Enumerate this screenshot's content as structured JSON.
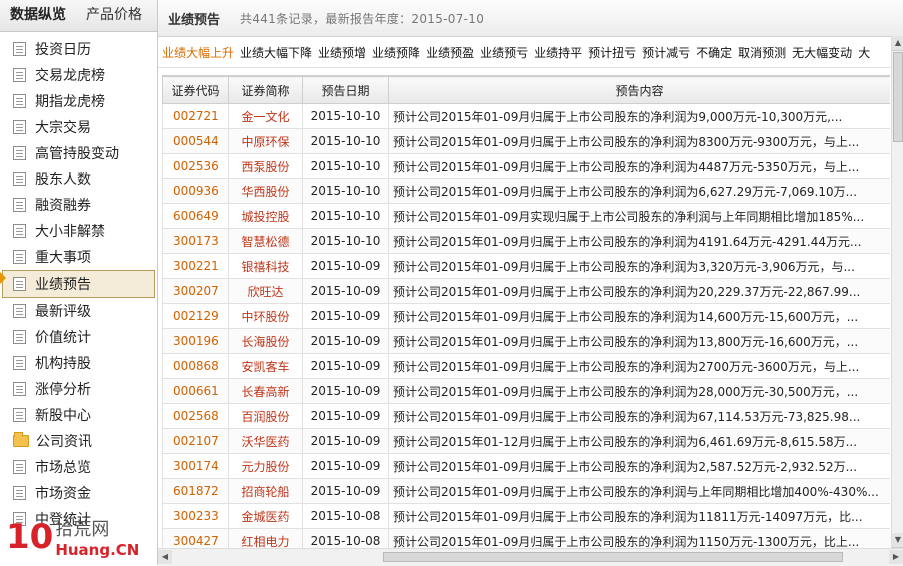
{
  "sidebar": {
    "tabs": [
      {
        "label": "数据纵览"
      },
      {
        "label": "产品价格"
      }
    ],
    "items": [
      {
        "label": "投资日历"
      },
      {
        "label": "交易龙虎榜"
      },
      {
        "label": "期指龙虎榜"
      },
      {
        "label": "大宗交易"
      },
      {
        "label": "高管持股变动"
      },
      {
        "label": "股东人数"
      },
      {
        "label": "融资融券"
      },
      {
        "label": "大小非解禁"
      },
      {
        "label": "重大事项"
      },
      {
        "label": "业绩预告"
      },
      {
        "label": "最新评级"
      },
      {
        "label": "价值统计"
      },
      {
        "label": "机构持股"
      },
      {
        "label": "涨停分析"
      },
      {
        "label": "新股中心"
      },
      {
        "label": "公司资讯"
      },
      {
        "label": "市场总览"
      },
      {
        "label": "市场资金"
      },
      {
        "label": "中登统计"
      }
    ]
  },
  "header": {
    "title": "业绩预告",
    "subtitle": "共441条记录，最新报告年度：2015-07-10"
  },
  "filters": [
    "业绩大幅上升",
    "业绩大幅下降",
    "业绩预增",
    "业绩预降",
    "业绩预盈",
    "业绩预亏",
    "业绩持平",
    "预计扭亏",
    "预计减亏",
    "不确定",
    "取消预测",
    "无大幅变动",
    "大"
  ],
  "table": {
    "columns": [
      "证券代码",
      "证券简称",
      "预告日期",
      "预告内容"
    ],
    "rows": [
      {
        "code": "002721",
        "name": "金一文化",
        "date": "2015-10-10",
        "content": "预计公司2015年01-09月归属于上市公司股东的净利润为9,000万元-10,300万元,..."
      },
      {
        "code": "000544",
        "name": "中原环保",
        "date": "2015-10-10",
        "content": "预计公司2015年01-09月归属于上市公司股东的净利润为8300万元-9300万元，与上..."
      },
      {
        "code": "002536",
        "name": "西泵股份",
        "date": "2015-10-10",
        "content": "预计公司2015年01-09月归属于上市公司股东的净利润为4487万元-5350万元，与上..."
      },
      {
        "code": "000936",
        "name": "华西股份",
        "date": "2015-10-10",
        "content": "预计公司2015年01-09月归属于上市公司股东的净利润为6,627.29万元-7,069.10万..."
      },
      {
        "code": "600649",
        "name": "城投控股",
        "date": "2015-10-10",
        "content": "预计公司2015年01-09月实现归属于上市公司股东的净利润与上年同期相比增加185%..."
      },
      {
        "code": "300173",
        "name": "智慧松德",
        "date": "2015-10-10",
        "content": "预计公司2015年01-09月归属于上市公司股东的净利润为4191.64万元-4291.44万元..."
      },
      {
        "code": "300221",
        "name": "银禧科技",
        "date": "2015-10-09",
        "content": "预计公司2015年01-09月归属于上市公司股东的净利润为3,320万元-3,906万元，与..."
      },
      {
        "code": "300207",
        "name": "欣旺达",
        "date": "2015-10-09",
        "content": "预计公司2015年01-09月归属于上市公司股东的净利润为20,229.37万元-22,867.99..."
      },
      {
        "code": "002129",
        "name": "中环股份",
        "date": "2015-10-09",
        "content": "预计公司2015年01-09月归属于上市公司股东的净利润为14,600万元-15,600万元，..."
      },
      {
        "code": "300196",
        "name": "长海股份",
        "date": "2015-10-09",
        "content": "预计公司2015年01-09月归属于上市公司股东的净利润为13,800万元-16,600万元，..."
      },
      {
        "code": "000868",
        "name": "安凯客车",
        "date": "2015-10-09",
        "content": "预计公司2015年01-09月归属于上市公司股东的净利润为2700万元-3600万元，与上..."
      },
      {
        "code": "000661",
        "name": "长春高新",
        "date": "2015-10-09",
        "content": "预计公司2015年01-09月归属于上市公司股东的净利润为28,000万元-30,500万元，..."
      },
      {
        "code": "002568",
        "name": "百润股份",
        "date": "2015-10-09",
        "content": "预计公司2015年01-09月归属于上市公司股东的净利润为67,114.53万元-73,825.98..."
      },
      {
        "code": "002107",
        "name": "沃华医药",
        "date": "2015-10-09",
        "content": "预计公司2015年01-12月归属于上市公司股东的净利润为6,461.69万元-8,615.58万..."
      },
      {
        "code": "300174",
        "name": "元力股份",
        "date": "2015-10-09",
        "content": "预计公司2015年01-09月归属于上市公司股东的净利润为2,587.52万元-2,932.52万..."
      },
      {
        "code": "601872",
        "name": "招商轮船",
        "date": "2015-10-09",
        "content": "预计公司2015年01-09月归属于上市公司股东的净利润与上年同期相比增加400%-430%..."
      },
      {
        "code": "300233",
        "name": "金城医药",
        "date": "2015-10-08",
        "content": "预计公司2015年01-09月归属于上市公司股东的净利润为11811万元-14097万元，比..."
      },
      {
        "code": "300427",
        "name": "红相电力",
        "date": "2015-10-08",
        "content": "预计公司2015年01-09月归属于上市公司股东的净利润为1150万元-1300万元，比上..."
      }
    ]
  },
  "watermark": {
    "num": "10",
    "top": "拾荒网",
    "bottom": "Huang.CN"
  }
}
